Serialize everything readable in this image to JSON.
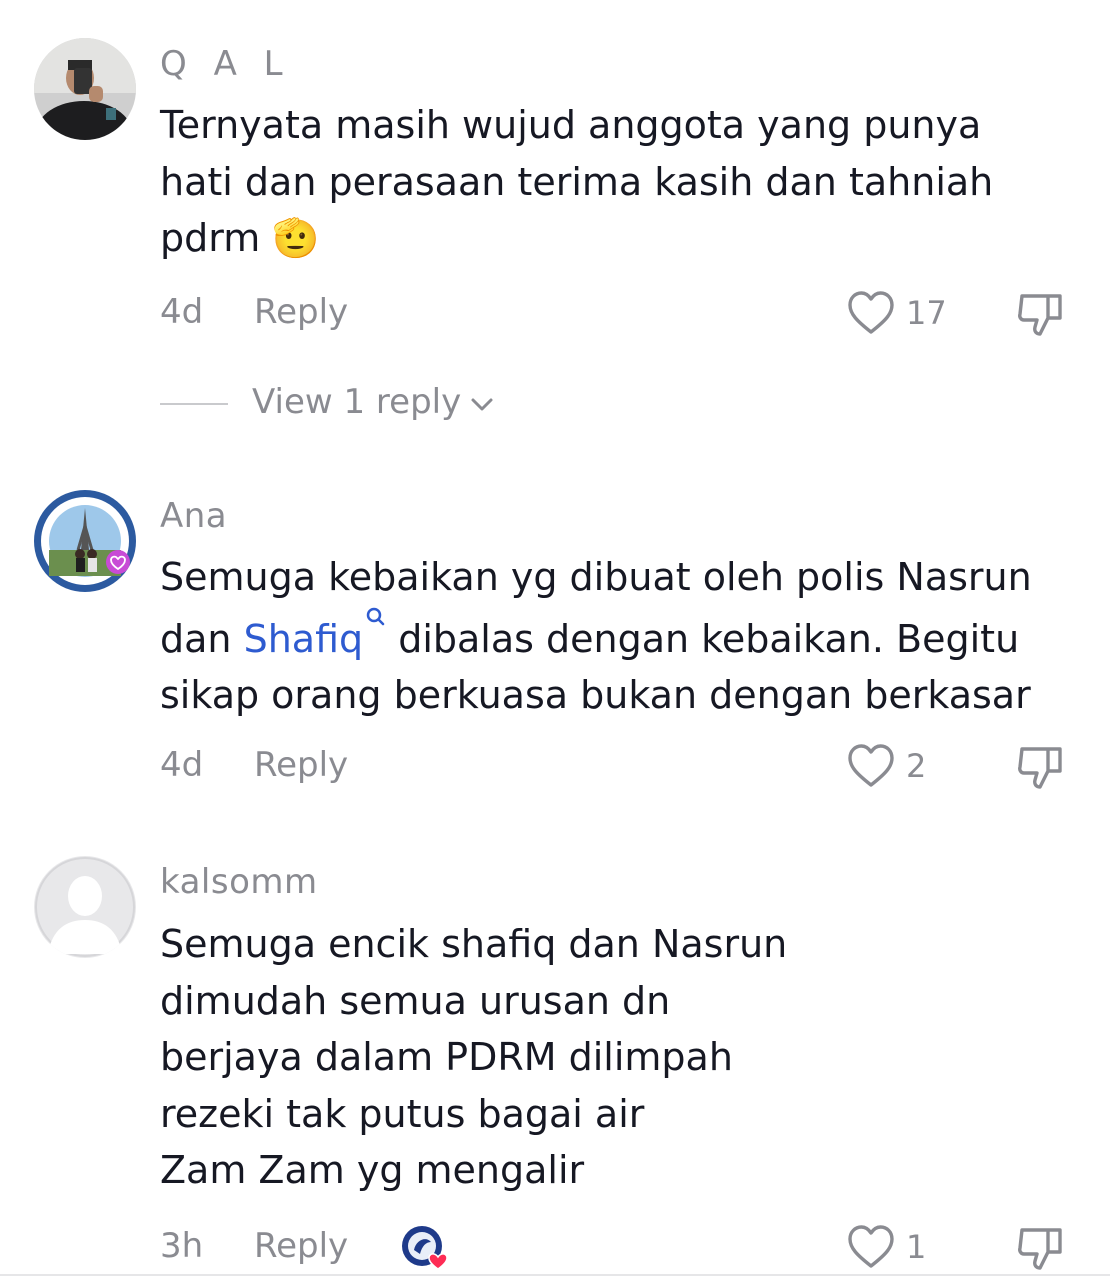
{
  "comments": [
    {
      "username": "Q A L",
      "text": "Ternyata masih wujud anggota yang punya",
      "text2": "hati dan perasaan terima kasih dan tahniah",
      "text3": "pdrm",
      "emoji": "🫡",
      "emoji_name": "saluting-face-icon",
      "time": "4d",
      "reply_label": "Reply",
      "likes": "17",
      "view_replies_label": "View 1 reply"
    },
    {
      "username": "Ana",
      "line1": "Semuga kebaikan yg dibuat oleh polis Nasrun",
      "line2_prefix": "dan ",
      "mention": "Shafiq",
      "line2_suffix": " dibalas dengan kebaikan. Begitu",
      "line3": "sikap orang berkuasa bukan dengan berkasar",
      "time": "4d",
      "reply_label": "Reply",
      "likes": "2"
    },
    {
      "username": "kalsomm",
      "lines": [
        "Semuga encik shafiq dan Nasrun",
        "dimudah semua urusan dn",
        "berjaya dalam PDRM dilimpah",
        "rezeki tak putus bagai air",
        "Zam Zam yg mengalir"
      ],
      "time": "3h",
      "reply_label": "Reply",
      "likes": "1"
    }
  ],
  "colors": {
    "text": "#161823",
    "muted": "#8a8b91",
    "mention": "#2e5bd0",
    "creator_heart": "#fe2c55"
  }
}
